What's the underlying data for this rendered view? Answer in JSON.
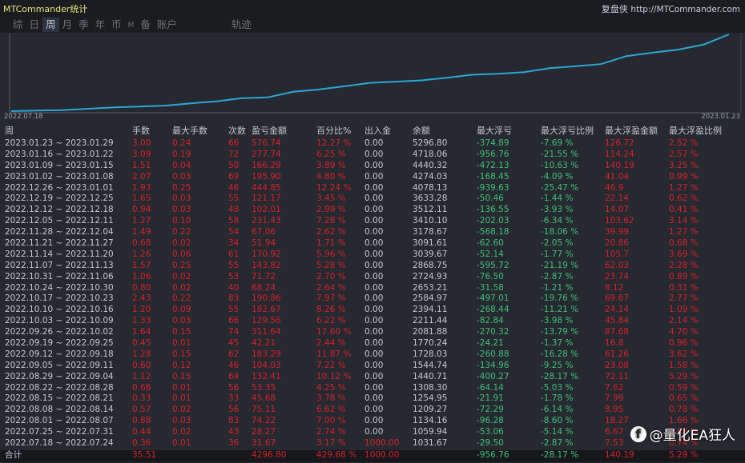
{
  "app": {
    "title": "MTCommander统计",
    "brand": "复盘侠",
    "url": "http://MTCommander.com"
  },
  "tabs": [
    {
      "label": "综"
    },
    {
      "label": "日"
    },
    {
      "label": "周",
      "active": true
    },
    {
      "label": "月"
    },
    {
      "label": "季"
    },
    {
      "label": "年"
    },
    {
      "label": "币"
    },
    {
      "label": "M"
    },
    {
      "label": "备"
    },
    {
      "label": "账户"
    },
    {
      "label": "轨迹"
    }
  ],
  "chart_data": {
    "type": "line",
    "title": "",
    "x_start_label": "2022.07.18",
    "x_end_label": "2023.01.23",
    "line_color": "#2aa7d6",
    "series": [
      {
        "name": "余额",
        "values": [
          1000.0,
          1031.67,
          1059.94,
          1134.16,
          1209.27,
          1254.95,
          1308.3,
          1440.71,
          1544.74,
          1728.03,
          1770.24,
          2081.88,
          2211.44,
          2394.11,
          2584.97,
          2653.21,
          2724.93,
          2868.75,
          3039.67,
          3091.61,
          3178.67,
          3410.1,
          3512.11,
          3633.28,
          4078.13,
          4274.03,
          4440.32,
          4718.06,
          5296.8
        ]
      }
    ]
  },
  "table": {
    "headers": [
      "周",
      "手数",
      "最大手数",
      "次数",
      "盈亏金额",
      "百分比%",
      "出入金",
      "余额",
      "最大浮亏",
      "最大浮亏比例",
      "最大浮盈金额",
      "最大浮盈比例"
    ],
    "rows": [
      [
        "2023.01.23 ~ 2023.01.29",
        "3.00",
        "0.24",
        "66",
        "576.74",
        "12.27 %",
        "0.00",
        "5296.80",
        "-374.89",
        "-7.69 %",
        "126.72",
        "2.52 %"
      ],
      [
        "2023.01.16 ~ 2023.01.22",
        "3.09",
        "0.19",
        "72",
        "277.74",
        "6.25 %",
        "0.00",
        "4718.06",
        "-956.76",
        "-21.55 %",
        "114.24",
        "2.57 %"
      ],
      [
        "2023.01.09 ~ 2023.01.15",
        "1.51",
        "0.04",
        "50",
        "166.29",
        "3.89 %",
        "0.00",
        "4440.32",
        "-472.13",
        "-10.63 %",
        "140.19",
        "3.25 %"
      ],
      [
        "2023.01.02 ~ 2023.01.08",
        "2.07",
        "0.03",
        "69",
        "195.90",
        "4.80 %",
        "0.00",
        "4274.03",
        "-168.45",
        "-4.09 %",
        "41.04",
        "0.99 %"
      ],
      [
        "2022.12.26 ~ 2023.01.01",
        "1.93",
        "0.25",
        "46",
        "444.85",
        "12.24 %",
        "0.00",
        "4078.13",
        "-939.63",
        "-25.47 %",
        "46.9",
        "1.27 %"
      ],
      [
        "2022.12.19 ~ 2022.12.25",
        "1.65",
        "0.03",
        "55",
        "121.17",
        "3.45 %",
        "0.00",
        "3633.28",
        "-50.46",
        "-1.44 %",
        "22.14",
        "0.62 %"
      ],
      [
        "2022.12.12 ~ 2022.12.18",
        "0.94",
        "0.03",
        "48",
        "102.01",
        "2.99 %",
        "0.00",
        "3512.11",
        "-136.55",
        "-3.93 %",
        "14.07",
        "0.41 %"
      ],
      [
        "2022.12.05 ~ 2022.12.11",
        "1.27",
        "0.10",
        "58",
        "231.43",
        "7.28 %",
        "0.00",
        "3410.10",
        "-202.03",
        "-6.34 %",
        "103.62",
        "3.14 %"
      ],
      [
        "2022.11.28 ~ 2022.12.04",
        "1.49",
        "0.22",
        "54",
        "67.06",
        "2.62 %",
        "0.00",
        "3178.67",
        "-568.18",
        "-18.06 %",
        "39.99",
        "1.27 %"
      ],
      [
        "2022.11.21 ~ 2022.11.27",
        "0.68",
        "0.02",
        "34",
        "51.94",
        "1.71 %",
        "0.00",
        "3091.61",
        "-62.60",
        "-2.05 %",
        "20.86",
        "0.68 %"
      ],
      [
        "2022.11.14 ~ 2022.11.20",
        "1.26",
        "0.06",
        "61",
        "170.92",
        "5.96 %",
        "0.00",
        "3039.67",
        "-52.14",
        "-1.77 %",
        "105.7",
        "3.69 %"
      ],
      [
        "2022.11.07 ~ 2022.11.13",
        "1.57",
        "0.25",
        "55",
        "143.82",
        "5.28 %",
        "0.00",
        "2868.75",
        "-595.72",
        "-21.19 %",
        "62.03",
        "2.28 %"
      ],
      [
        "2022.10.31 ~ 2022.11.06",
        "1.06",
        "0.02",
        "53",
        "71.72",
        "2.70 %",
        "0.00",
        "2724.93",
        "-76.50",
        "-2.87 %",
        "23.74",
        "0.89 %"
      ],
      [
        "2022.10.24 ~ 2022.10.30",
        "0.80",
        "0.02",
        "40",
        "68.24",
        "2.64 %",
        "0.00",
        "2653.21",
        "-31.58",
        "-1.21 %",
        "8.12",
        "0.31 %"
      ],
      [
        "2022.10.17 ~ 2022.10.23",
        "2.43",
        "0.22",
        "83",
        "190.86",
        "7.97 %",
        "0.00",
        "2584.97",
        "-497.01",
        "-19.76 %",
        "69.67",
        "2.77 %"
      ],
      [
        "2022.10.10 ~ 2022.10.16",
        "1.20",
        "0.09",
        "55",
        "182.67",
        "8.26 %",
        "0.00",
        "2394.11",
        "-268.44",
        "-11.21 %",
        "24.14",
        "1.09 %"
      ],
      [
        "2022.10.03 ~ 2022.10.09",
        "1.33",
        "0.03",
        "66",
        "129.56",
        "6.22 %",
        "0.00",
        "2211.44",
        "-82.84",
        "-3.98 %",
        "45.84",
        "2.14 %"
      ],
      [
        "2022.09.26 ~ 2022.10.02",
        "1.64",
        "0.15",
        "74",
        "311.64",
        "17.60 %",
        "0.00",
        "2081.88",
        "-270.32",
        "-13.79 %",
        "87.68",
        "4.70 %"
      ],
      [
        "2022.09.19 ~ 2022.09.25",
        "0.45",
        "0.01",
        "45",
        "42.21",
        "2.44 %",
        "0.00",
        "1770.24",
        "-24.21",
        "-1.37 %",
        "16.8",
        "0.96 %"
      ],
      [
        "2022.09.12 ~ 2022.09.18",
        "1.28",
        "0.15",
        "62",
        "183.29",
        "11.87 %",
        "0.00",
        "1728.03",
        "-260.88",
        "-16.28 %",
        "61.26",
        "3.62 %"
      ],
      [
        "2022.09.05 ~ 2022.09.11",
        "0.60",
        "0.12",
        "46",
        "104.03",
        "7.22 %",
        "0.00",
        "1544.74",
        "-134.96",
        "-9.25 %",
        "23.08",
        "1.58 %"
      ],
      [
        "2022.08.29 ~ 2022.09.04",
        "1.12",
        "0.15",
        "64",
        "132.41",
        "10.12 %",
        "0.00",
        "1440.71",
        "-400.27",
        "-28.17 %",
        "72.11",
        "5.29 %"
      ],
      [
        "2022.08.22 ~ 2022.08.28",
        "0.66",
        "0.01",
        "56",
        "53.35",
        "4.25 %",
        "0.00",
        "1308.30",
        "-64.14",
        "-5.03 %",
        "7.62",
        "0.59 %"
      ],
      [
        "2022.08.15 ~ 2022.08.21",
        "0.33",
        "0.01",
        "33",
        "45.68",
        "3.78 %",
        "0.00",
        "1254.95",
        "-21.91",
        "-1.78 %",
        "7.99",
        "0.65 %"
      ],
      [
        "2022.08.08 ~ 2022.08.14",
        "0.57",
        "0.02",
        "56",
        "75.11",
        "6.62 %",
        "0.00",
        "1209.27",
        "-72.29",
        "-6.14 %",
        "8.95",
        "0.78 %"
      ],
      [
        "2022.08.01 ~ 2022.08.07",
        "0.88",
        "0.03",
        "83",
        "74.22",
        "7.00 %",
        "0.00",
        "1134.16",
        "-96.28",
        "-8.60 %",
        "18.27",
        "1.66 %"
      ],
      [
        "2022.07.25 ~ 2022.07.31",
        "0.44",
        "0.02",
        "43",
        "28.27",
        "2.74 %",
        "0.00",
        "1059.94",
        "-53.06",
        "-5.14 %",
        "6.67",
        "0.63 %"
      ],
      [
        "2022.07.18 ~ 2022.07.24",
        "0.36",
        "0.01",
        "36",
        "31.67",
        "3.17 %",
        "1000.00",
        "1031.67",
        "-29.50",
        "-2.87 %",
        "7.53",
        "0.74 %"
      ]
    ],
    "total": [
      "合计",
      "35.51",
      "",
      "",
      "4296.80",
      "429.68 %",
      "1000.00",
      "",
      "-956.76",
      "-28.17 %",
      "140.19",
      "5.29 %"
    ]
  },
  "watermark": "@量化EA狂人",
  "colors": {
    "positive": "#d8202a",
    "negative": "#3ec07a",
    "line": "#2aa7d6"
  }
}
